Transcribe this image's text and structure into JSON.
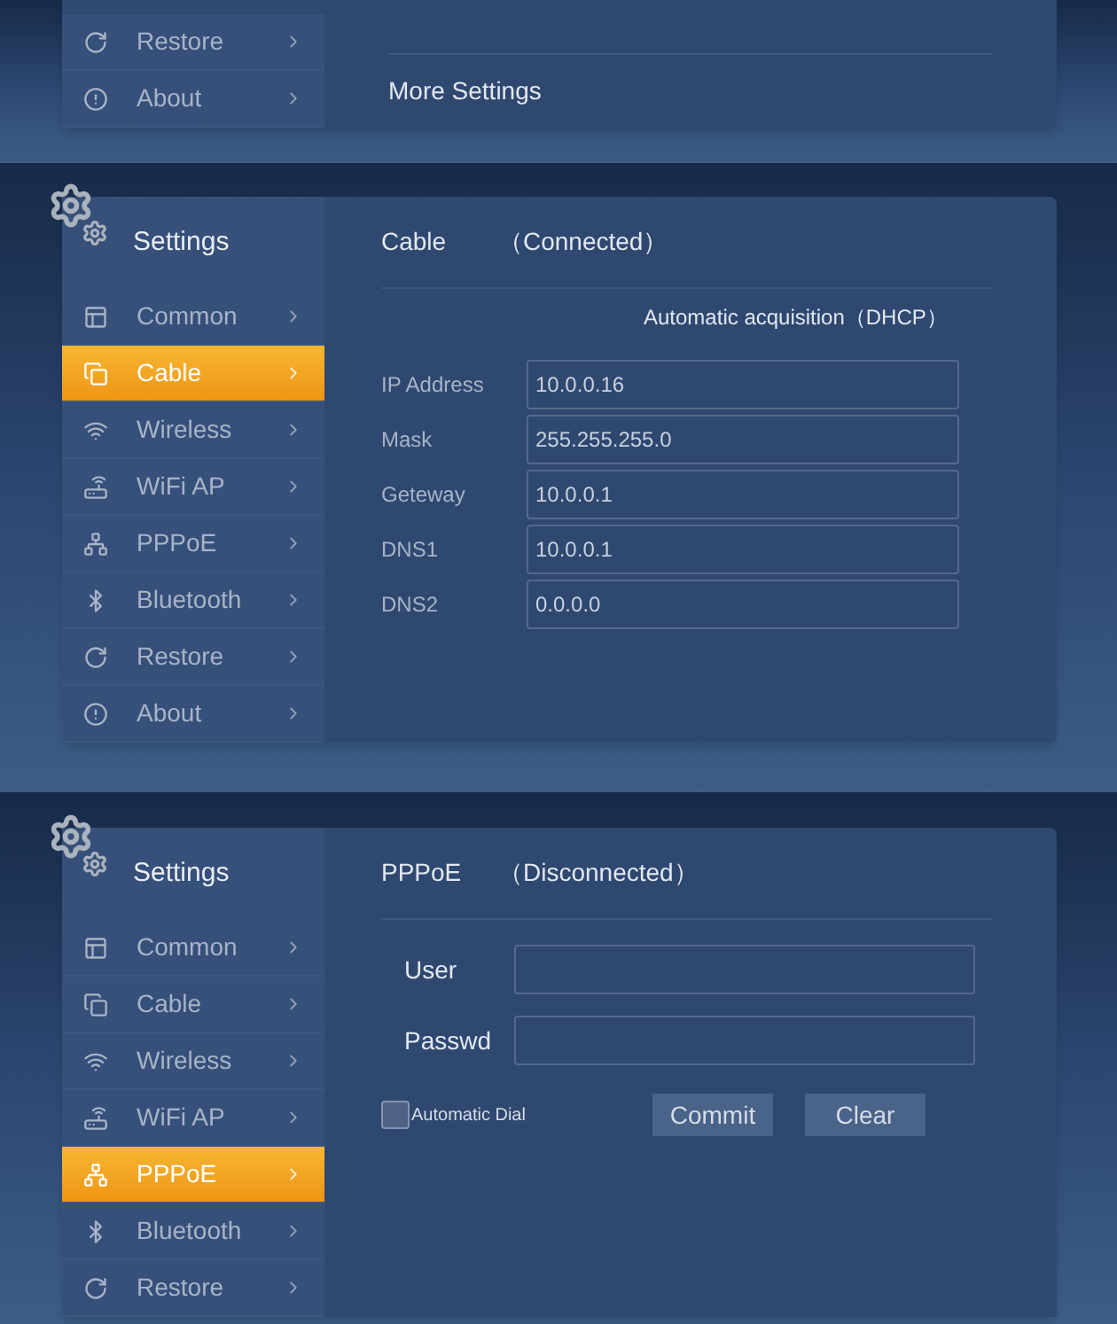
{
  "screens": [
    {
      "sidebar": {
        "items": [
          {
            "label": "Restore",
            "kind": "restore",
            "selected": false
          },
          {
            "label": "About",
            "kind": "about",
            "selected": false
          }
        ]
      },
      "content": {
        "kind": "more",
        "items": [
          "More Settings"
        ]
      }
    },
    {
      "sidebar": {
        "title": "Settings",
        "items": [
          {
            "label": "Common",
            "kind": "common",
            "selected": false
          },
          {
            "label": "Cable",
            "kind": "cable",
            "selected": true
          },
          {
            "label": "Wireless",
            "kind": "wireless",
            "selected": false
          },
          {
            "label": "WiFi AP",
            "kind": "wifiap",
            "selected": false
          },
          {
            "label": "PPPoE",
            "kind": "pppoe",
            "selected": false
          },
          {
            "label": "Bluetooth",
            "kind": "bluetooth",
            "selected": false
          },
          {
            "label": "Restore",
            "kind": "restore",
            "selected": false
          },
          {
            "label": "About",
            "kind": "about",
            "selected": false
          }
        ]
      },
      "content": {
        "kind": "network",
        "title": "Cable",
        "status": "（Connected）",
        "mode": "Automatic acquisition（DHCP）",
        "fields": [
          {
            "label": "IP Address",
            "value": "10.0.0.16"
          },
          {
            "label": "Mask",
            "value": "255.255.255.0"
          },
          {
            "label": "Geteway",
            "value": "10.0.0.1"
          },
          {
            "label": "DNS1",
            "value": "10.0.0.1"
          },
          {
            "label": "DNS2",
            "value": "0.0.0.0"
          }
        ]
      }
    },
    {
      "sidebar": {
        "title": "Settings",
        "items": [
          {
            "label": "Common",
            "kind": "common",
            "selected": false
          },
          {
            "label": "Cable",
            "kind": "cable",
            "selected": false
          },
          {
            "label": "Wireless",
            "kind": "wireless",
            "selected": false
          },
          {
            "label": "WiFi AP",
            "kind": "wifiap",
            "selected": false
          },
          {
            "label": "PPPoE",
            "kind": "pppoe",
            "selected": true
          },
          {
            "label": "Bluetooth",
            "kind": "bluetooth",
            "selected": false
          },
          {
            "label": "Restore",
            "kind": "restore",
            "selected": false
          }
        ]
      },
      "content": {
        "kind": "pppoe",
        "title": "PPPoE",
        "status": "（Disconnected）",
        "fields": [
          {
            "label": "User"
          },
          {
            "label": "Passwd"
          }
        ],
        "automatic_dial": {
          "label": "Automatic Dial",
          "checked": false
        },
        "buttons": [
          "Commit",
          "Clear"
        ]
      }
    }
  ]
}
